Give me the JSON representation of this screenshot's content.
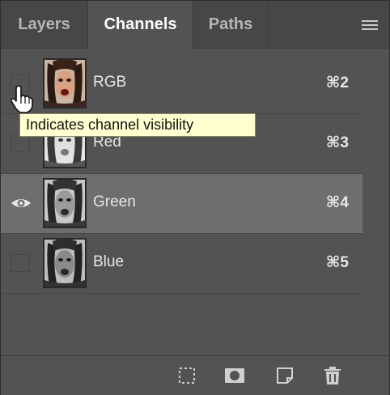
{
  "tabs": [
    {
      "label": "Layers",
      "active": false
    },
    {
      "label": "Channels",
      "active": true
    },
    {
      "label": "Paths",
      "active": false
    }
  ],
  "channels": [
    {
      "name": "RGB",
      "shortcut": "⌘2",
      "visible": false,
      "selected": false,
      "tint": "color"
    },
    {
      "name": "Red",
      "shortcut": "⌘3",
      "visible": false,
      "selected": false,
      "tint": "gray"
    },
    {
      "name": "Green",
      "shortcut": "⌘4",
      "visible": true,
      "selected": true,
      "tint": "gray"
    },
    {
      "name": "Blue",
      "shortcut": "⌘5",
      "visible": false,
      "selected": false,
      "tint": "gray"
    }
  ],
  "tooltip": "Indicates channel visibility",
  "footer": {
    "buttons": [
      "load-selection-icon",
      "save-selection-icon",
      "new-channel-icon",
      "trash-icon"
    ]
  },
  "colors": {
    "panel_bg": "#535353",
    "tab_bar_bg": "#474747",
    "selected_row": "#6e6e6e",
    "tooltip_bg": "#ffffd0"
  }
}
